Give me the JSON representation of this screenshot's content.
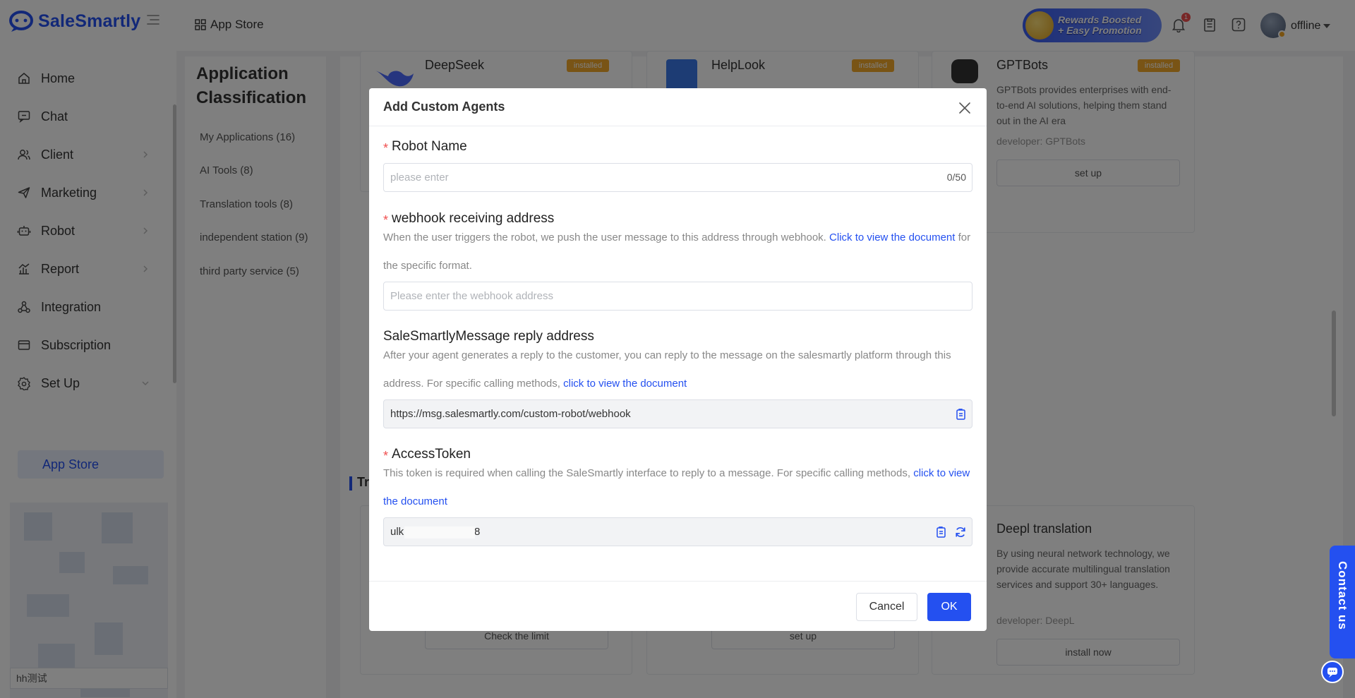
{
  "header": {
    "logo_text": "SaleSmartly",
    "breadcrumb": "App Store",
    "rewards_line1": "Rewards Boosted",
    "rewards_line2": "+ Easy Promotion",
    "notification_count": "1",
    "agent_status": "offline"
  },
  "sidebar": {
    "items": [
      {
        "label": "Home",
        "icon": "home-icon"
      },
      {
        "label": "Chat",
        "icon": "chat-icon"
      },
      {
        "label": "Client",
        "icon": "users-icon"
      },
      {
        "label": "Marketing",
        "icon": "send-icon"
      },
      {
        "label": "Robot",
        "icon": "robot-icon"
      },
      {
        "label": "Report",
        "icon": "chart-icon"
      },
      {
        "label": "Integration",
        "icon": "integration-icon"
      },
      {
        "label": "Subscription",
        "icon": "subscription-icon"
      },
      {
        "label": "Set Up",
        "icon": "gear-icon"
      }
    ],
    "active_sub": "App Store",
    "bottom_label": "hh测试"
  },
  "classification": {
    "title": "Application Classification",
    "items": [
      "My Applications (16)",
      "AI Tools (8)",
      "Translation tools (8)",
      "independent station (9)",
      "third party service (5)"
    ]
  },
  "cards": {
    "deepseek_title": "DeepSeek",
    "deepseek_badge": "installed",
    "helplook_title": "HelpLook",
    "helplook_badge": "installed",
    "gptbots_title": "GPTBots",
    "gptbots_badge": "installed",
    "gptbots_desc": "GPTBots provides enterprises with end-to-end AI solutions, helping them stand out in the AI era",
    "gptbots_dev": "developer: GPTBots",
    "gptbots_btn": "set up",
    "section_label": "Tr",
    "deepl_title": "Deepl translation",
    "deepl_desc": "By using neural network technology, we provide accurate multilingual translation services and support 30+ languages.",
    "deepl_dev": "developer: DeepL",
    "deepl_btn": "install now",
    "left_btn": "Check the limit",
    "mid_btn": "set up"
  },
  "contact": {
    "label": "Contact us"
  },
  "modal": {
    "title": "Add Custom Agents",
    "robot_name": {
      "label": "Robot Name",
      "placeholder": "please enter",
      "count": "0/50"
    },
    "webhook": {
      "label": "webhook receiving address",
      "desc_before": "When the user triggers the robot, we push the user message to this address through webhook.",
      "desc_link": "Click to view the document",
      "desc_after": "for the specific format.",
      "placeholder": "Please enter the webhook address"
    },
    "reply": {
      "label": "SaleSmartlyMessage reply address",
      "desc_before": "After your agent generates a reply to the customer, you can reply to the message on the salesmartly platform through this address. For specific calling methods,",
      "desc_link": "click to view the document",
      "value": "https://msg.salesmartly.com/custom-robot/webhook"
    },
    "token": {
      "label": "AccessToken",
      "desc_before": "This token is required when calling the SaleSmartly interface to reply to a message. For specific calling methods,",
      "desc_link": "click to view the document",
      "value_prefix": "ulk",
      "value_suffix": "8"
    },
    "cancel_label": "Cancel",
    "ok_label": "OK"
  },
  "colors": {
    "primary": "#2450f0",
    "required": "#f04f4f",
    "badge": "#f3a82a"
  }
}
